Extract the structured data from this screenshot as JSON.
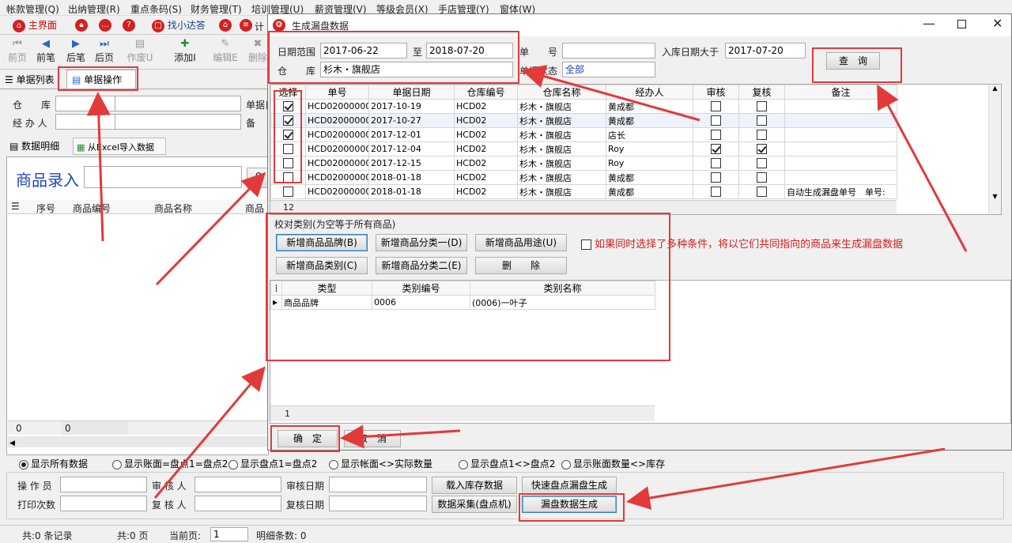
{
  "menu": [
    "帐款管理(Q)",
    "出纳管理(R)",
    "重点条码(S)",
    "财务管理(T)",
    "培训管理(U)",
    "薪资管理(V)",
    "等级会员(X)",
    "手店管理(Y)",
    "窗体(W)"
  ],
  "toolbar1": {
    "home": "主界面",
    "ask": "找小达答",
    "calc": "计"
  },
  "toolbar2": [
    "前页",
    "前笔",
    "后笔",
    "后页",
    "作废U",
    "添加I",
    "编辑E",
    "删除"
  ],
  "tabs": {
    "list": "单据列表",
    "op": "单据操作"
  },
  "left_form": {
    "warehouse_label": "仓　　库",
    "handler_label": "经 办 人",
    "docdate_label": "单据日",
    "note_label": "备"
  },
  "subtabs": {
    "detail": "数据明细",
    "excel": "从Excel导入数据"
  },
  "product_entry": {
    "label": "商品录入",
    "btn": "查"
  },
  "left_grid": {
    "headers": [
      "序号",
      "商品编号",
      "商品名称",
      "商品"
    ],
    "foot_a": "0",
    "foot_b": "0"
  },
  "dialog": {
    "title": "生成漏盘数据",
    "date_label": "日期范围",
    "date_from": "2017-06-22",
    "to_label": "至",
    "date_to": "2018-07-20",
    "docno_label": "单　　号",
    "docno_value": "",
    "indate_label": "入库日期大于",
    "indate_value": "2017-07-20",
    "wh_label": "仓　　库",
    "wh_value": "杉木・旗舰店",
    "status_label": "单据状态",
    "status_value": "全部",
    "query_btn": "查　询",
    "grid_headers": [
      "选择",
      "单号",
      "单据日期",
      "仓库编号",
      "仓库名称",
      "经办人",
      "审核",
      "复核",
      "备注"
    ],
    "rows": [
      {
        "sel": true,
        "no": "HCD020000001",
        "date": "2017-10-19",
        "whno": "HCD02",
        "whname": "杉木・旗舰店",
        "handler": "黄成都",
        "audit": false,
        "review": false,
        "note": ""
      },
      {
        "sel": true,
        "no": "HCD020000002",
        "date": "2017-10-27",
        "whno": "HCD02",
        "whname": "杉木・旗舰店",
        "handler": "黄成都",
        "audit": false,
        "review": false,
        "note": ""
      },
      {
        "sel": true,
        "no": "HCD020000003",
        "date": "2017-12-01",
        "whno": "HCD02",
        "whname": "杉木・旗舰店",
        "handler": "店长",
        "audit": false,
        "review": false,
        "note": ""
      },
      {
        "sel": false,
        "no": "HCD020000004",
        "date": "2017-12-04",
        "whno": "HCD02",
        "whname": "杉木・旗舰店",
        "handler": "Roy",
        "audit": true,
        "review": true,
        "note": ""
      },
      {
        "sel": false,
        "no": "HCD020000005",
        "date": "2017-12-15",
        "whno": "HCD02",
        "whname": "杉木・旗舰店",
        "handler": "Roy",
        "audit": false,
        "review": false,
        "note": ""
      },
      {
        "sel": false,
        "no": "HCD020000008",
        "date": "2018-01-18",
        "whno": "HCD02",
        "whname": "杉木・旗舰店",
        "handler": "黄成都",
        "audit": false,
        "review": false,
        "note": ""
      },
      {
        "sel": false,
        "no": "HCD020000009",
        "date": "2018-01-18",
        "whno": "HCD02",
        "whname": "杉木・旗舰店",
        "handler": "黄成都",
        "audit": false,
        "review": false,
        "note": "自动生成漏盘单号　单号:"
      }
    ],
    "row_count": "12",
    "check_title": "校对类别(为空等于所有商品)",
    "btn_brand": "新增商品品牌(B)",
    "btn_cat1": "新增商品分类一(D)",
    "btn_use": "新增商品用途(U)",
    "btn_type": "新增商品类别(C)",
    "btn_cat2": "新增商品分类二(E)",
    "btn_del": "删　　除",
    "multi_note": "如果同时选择了多种条件，将以它们共同指向的商品来生成漏盘数据",
    "cat_headers": [
      "类型",
      "类别编号",
      "类别名称"
    ],
    "cat_rows": [
      {
        "type": "商品品牌",
        "code": "0006",
        "name": "(0006)一叶子"
      }
    ],
    "cat_count": "1",
    "ok_btn": "确　定",
    "cancel_btn": "取　消"
  },
  "radios": [
    {
      "label": "显示所有数据",
      "on": true
    },
    {
      "label": "显示账面=盘点1=盘点2",
      "on": false
    },
    {
      "label": "显示盘点1=盘点2",
      "on": false
    },
    {
      "label": "显示帐面<>实际数量",
      "on": false
    },
    {
      "label": "显示盘点1<>盘点2",
      "on": false
    },
    {
      "label": "显示账面数量<>库存",
      "on": false
    }
  ],
  "bottom_form": {
    "operator": "操 作 员",
    "auditor": "审 核 人",
    "audit_date": "审核日期",
    "print_count": "打印次数",
    "reviewer": "复 核 人",
    "review_date": "复核日期",
    "btn_load": "载入库存数据",
    "btn_quick": "快速盘点漏盘生成",
    "btn_collect": "数据采集(盘点机)",
    "btn_gen": "漏盘数据生成"
  },
  "status": {
    "records": "共:0 条记录",
    "pages": "共:0 页",
    "cur_label": "当前页:",
    "cur_value": "1",
    "detail": "明细条数: 0"
  }
}
